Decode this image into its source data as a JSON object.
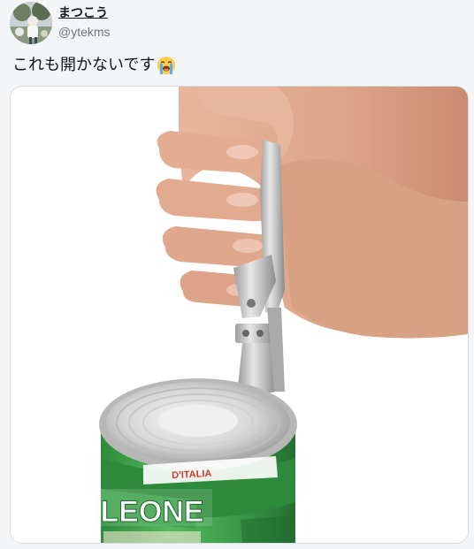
{
  "user": {
    "display_name": "まつこう",
    "handle": "@ytekms"
  },
  "tweet": {
    "text": "これも開かないです",
    "emoji": "loudly-crying-face"
  },
  "media": {
    "description_icon": "photo-can-opener",
    "can_brand": "LEONE",
    "can_small_text": "D'ITALIA",
    "colors": {
      "can_green": "#3a9a4a",
      "can_red": "#d23a32",
      "metal": "#cfcfcf"
    }
  }
}
